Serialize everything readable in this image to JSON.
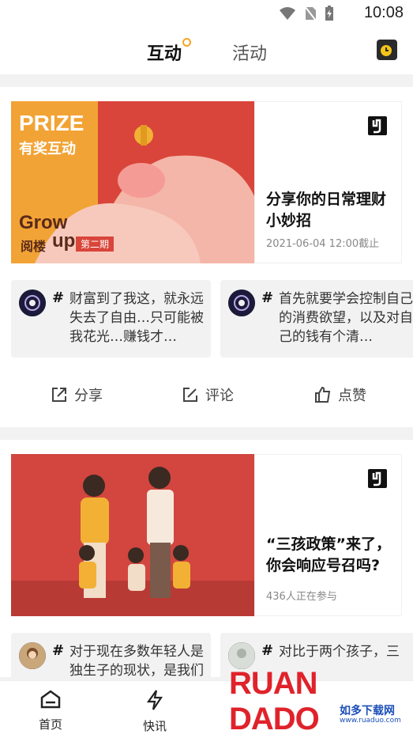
{
  "status_bar": {
    "time": "10:08"
  },
  "top_nav": {
    "tab_active": "互动",
    "tab_inactive": "活动"
  },
  "cards": [
    {
      "image_title": "PRIZE",
      "image_sub": "有奖互动",
      "image_tag_grow": "Grow",
      "image_tag_up": "up",
      "image_tag_brand": "阅楼",
      "image_tag_issue": "第二期",
      "title": "分享你的日常理财小妙招",
      "meta": "2021-06-04 12:00截止",
      "comments": [
        {
          "text": "财富到了我这，就永远失去了自由…只可能被我花光…赚钱才…"
        },
        {
          "text": "首先就要学会控制自己的消费欲望，以及对自己的钱有个清…"
        }
      ],
      "actions": {
        "share": "分享",
        "comment": "评论",
        "like": "点赞"
      }
    },
    {
      "title": "“三孩政策”来了，你会响应号召吗?",
      "meta": "436人正在参与",
      "comments": [
        {
          "text": "对于现在多数年轻人是独生子的现状，是我们生育率下降的…"
        },
        {
          "text": "对比于两个孩子，三"
        }
      ]
    }
  ],
  "bottom_nav": {
    "home": "首页",
    "news": "快讯"
  },
  "watermark": {
    "main": "RUAN DADO",
    "cn": "如多下载网",
    "url": "www.ruaduo.com"
  },
  "colors": {
    "accent": "#f5a623",
    "card1_bg": "#d9453a",
    "card2_bg": "#d2463f"
  }
}
